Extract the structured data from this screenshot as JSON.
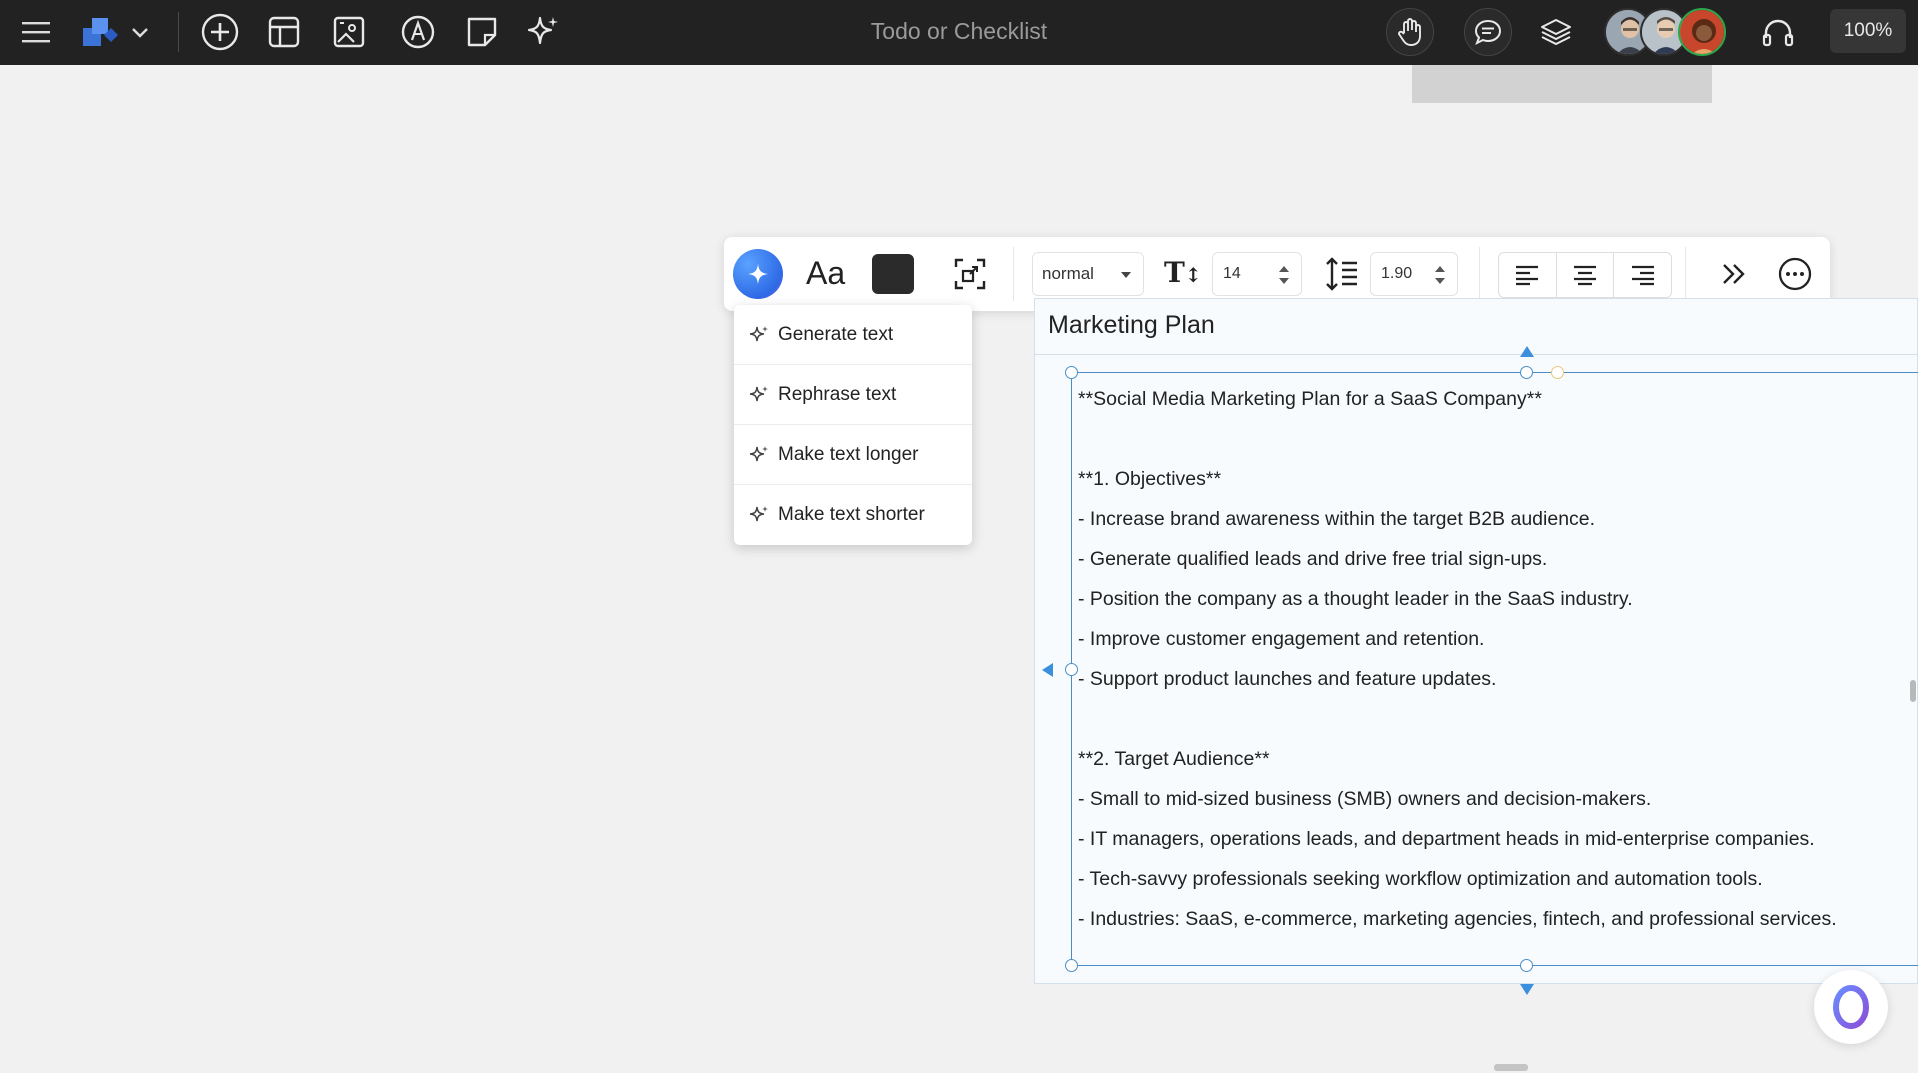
{
  "topbar": {
    "title": "Todo or Checklist",
    "zoom": "100%",
    "icons": [
      "menu-icon",
      "logo-shapes-icon",
      "chevron-down-icon",
      "add-circle-icon",
      "template-icon",
      "image-icon",
      "pen-icon",
      "sticky-note-icon",
      "ai-sparkle-icon",
      "hand-icon",
      "chat-icon",
      "layers-icon",
      "headphones-icon"
    ]
  },
  "toolbar": {
    "font_label": "Aa",
    "text_style": "normal",
    "font_size": "14",
    "line_height": "1.90",
    "text_color": "#2b2b2b"
  },
  "ai_menu": {
    "items": [
      {
        "label": "Generate text"
      },
      {
        "label": "Rephrase text"
      },
      {
        "label": "Make text longer"
      },
      {
        "label": "Make text shorter"
      }
    ]
  },
  "frame": {
    "title": "Marketing Plan",
    "lines": [
      "**Social Media Marketing Plan for a SaaS Company**",
      "",
      "**1. Objectives**",
      "- Increase brand awareness within the target B2B audience.",
      "- Generate qualified leads and drive free trial sign-ups.",
      "- Position the company as a thought leader in the SaaS industry.",
      "- Improve customer engagement and retention.",
      "- Support product launches and feature updates.",
      "",
      "**2. Target Audience**",
      "- Small to mid-sized business (SMB) owners and decision-makers.",
      "- IT managers, operations leads, and department heads in mid-enterprise companies.",
      "- Tech-savvy professionals seeking workflow optimization and automation tools.",
      "- Industries: SaaS, e-commerce, marketing agencies, fintech, and professional services."
    ]
  },
  "colors": {
    "topbar": "#222222",
    "accent": "#2e6ae6",
    "selection": "#4a8dc6"
  }
}
